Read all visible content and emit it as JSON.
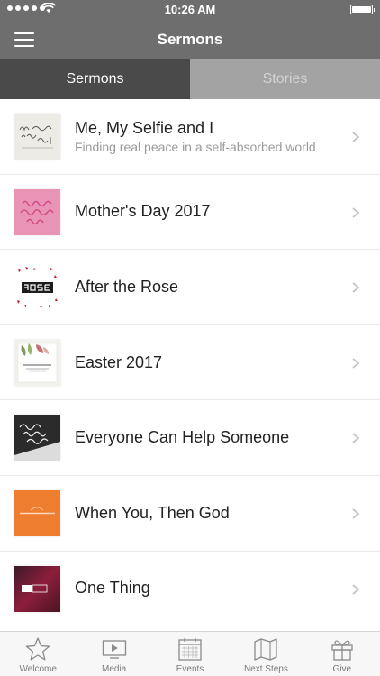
{
  "status_bar": {
    "time": "10:26 AM"
  },
  "nav": {
    "title": "Sermons",
    "menu_icon": "hamburger-menu-icon"
  },
  "tabs": [
    {
      "label": "Sermons",
      "active": true
    },
    {
      "label": "Stories",
      "active": false
    }
  ],
  "sermons": [
    {
      "title": "Me, My Selfie and I",
      "subtitle": "Finding real peace in a self-absorbed world",
      "thumb_text": "Me, My Selfie & I"
    },
    {
      "title": "Mother's Day 2017",
      "subtitle": "",
      "thumb_text": "Happy Mother's Day"
    },
    {
      "title": "After the Rose",
      "subtitle": "",
      "thumb_text": "ROSE"
    },
    {
      "title": "Easter 2017",
      "subtitle": "",
      "thumb_text": ""
    },
    {
      "title": "Everyone Can Help Someone",
      "subtitle": "",
      "thumb_text": "Everyone Can Help Someone"
    },
    {
      "title": "When You, Then God",
      "subtitle": "",
      "thumb_text": "when you, then God"
    },
    {
      "title": "One Thing",
      "subtitle": "",
      "thumb_text": "One Thing"
    }
  ],
  "tab_bar": [
    {
      "label": "Welcome",
      "icon": "star-icon"
    },
    {
      "label": "Media",
      "icon": "play-icon"
    },
    {
      "label": "Events",
      "icon": "calendar-icon"
    },
    {
      "label": "Next Steps",
      "icon": "map-icon"
    },
    {
      "label": "Give",
      "icon": "gift-icon"
    }
  ],
  "colors": {
    "header": "#6e6e6e",
    "tab_active": "#4a4a4a",
    "tab_inactive": "#a3a3a3"
  }
}
